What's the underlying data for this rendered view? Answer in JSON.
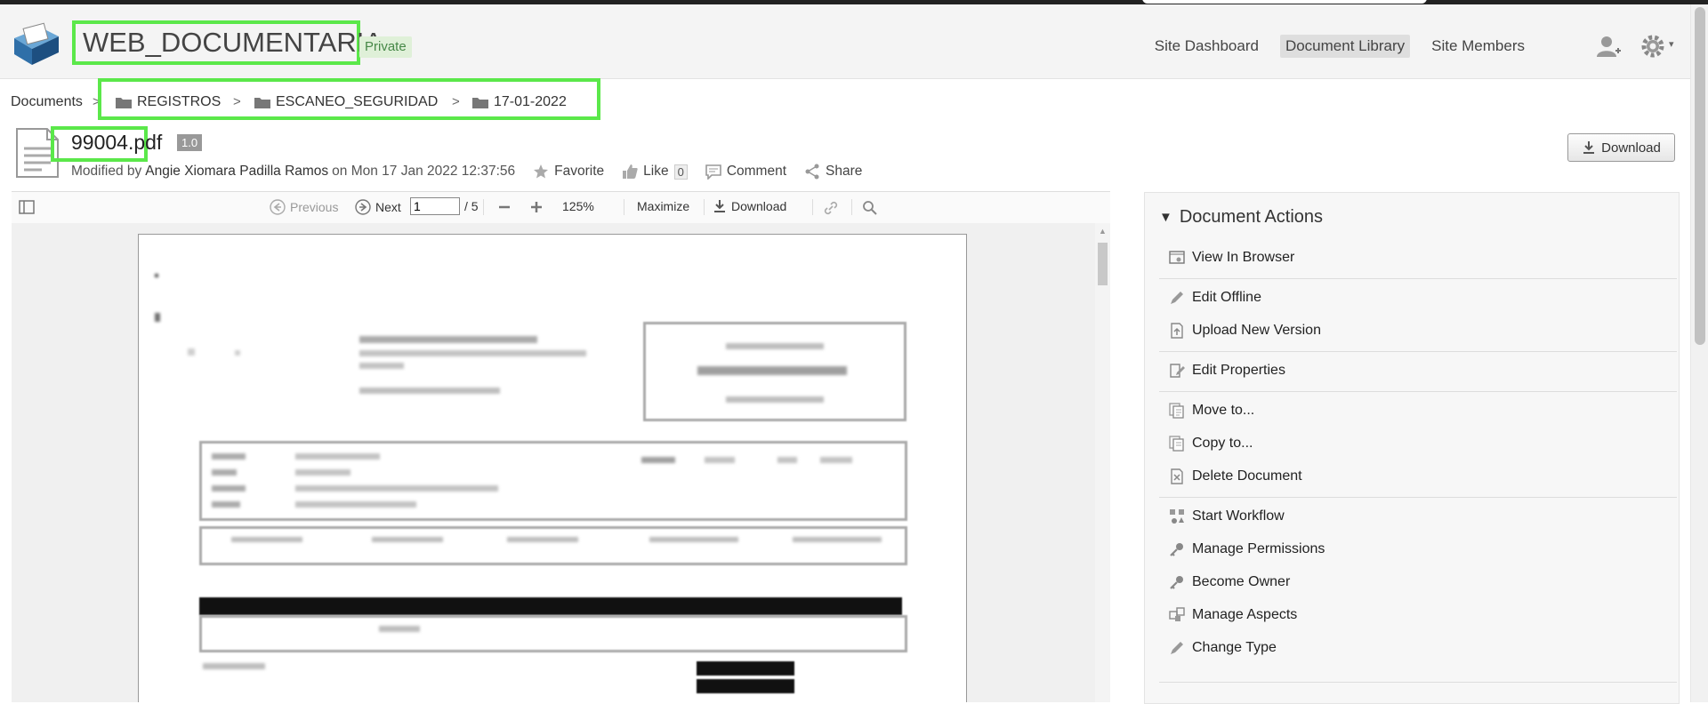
{
  "site": {
    "title": "WEB_DOCUMENTARIA",
    "visibility": "Private"
  },
  "nav": {
    "items": [
      "Site Dashboard",
      "Document Library",
      "Site Members"
    ],
    "active": "Document Library"
  },
  "breadcrumb": {
    "root": "Documents",
    "separator": ">",
    "folders": [
      "REGISTROS",
      "ESCANEO_SEGURIDAD",
      "17-01-2022"
    ]
  },
  "document": {
    "name": "99004.pdf",
    "version": "1.0",
    "modified_prefix": "Modified by",
    "modified_by": "Angie Xiomara Padilla Ramos",
    "modified_on": "on Mon 17 Jan 2022 12:37:56",
    "favorite_label": "Favorite",
    "like_label": "Like",
    "like_count": "0",
    "comment_label": "Comment",
    "share_label": "Share",
    "download_label": "Download"
  },
  "viewer": {
    "previous_label": "Previous",
    "next_label": "Next",
    "page_value": "1",
    "page_total": "/ 5",
    "zoom": "125%",
    "maximize_label": "Maximize",
    "download_label": "Download"
  },
  "actions": {
    "title": "Document Actions",
    "items": [
      {
        "label": "View In Browser",
        "icon": "view-browser-icon"
      },
      {
        "label": "Edit Offline",
        "icon": "pencil-icon"
      },
      {
        "label": "Upload New Version",
        "icon": "upload-icon"
      },
      {
        "label": "Edit Properties",
        "icon": "edit-properties-icon"
      },
      {
        "label": "Move to...",
        "icon": "move-icon"
      },
      {
        "label": "Copy to...",
        "icon": "copy-icon"
      },
      {
        "label": "Delete Document",
        "icon": "delete-icon"
      },
      {
        "label": "Start Workflow",
        "icon": "workflow-icon"
      },
      {
        "label": "Manage Permissions",
        "icon": "key-icon"
      },
      {
        "label": "Become Owner",
        "icon": "key-icon"
      },
      {
        "label": "Manage Aspects",
        "icon": "aspects-icon"
      },
      {
        "label": "Change Type",
        "icon": "pencil-icon"
      }
    ]
  },
  "colors": {
    "highlight": "#5be84a",
    "private_bg": "#dff0d8",
    "active_nav_bg": "#dedede"
  }
}
